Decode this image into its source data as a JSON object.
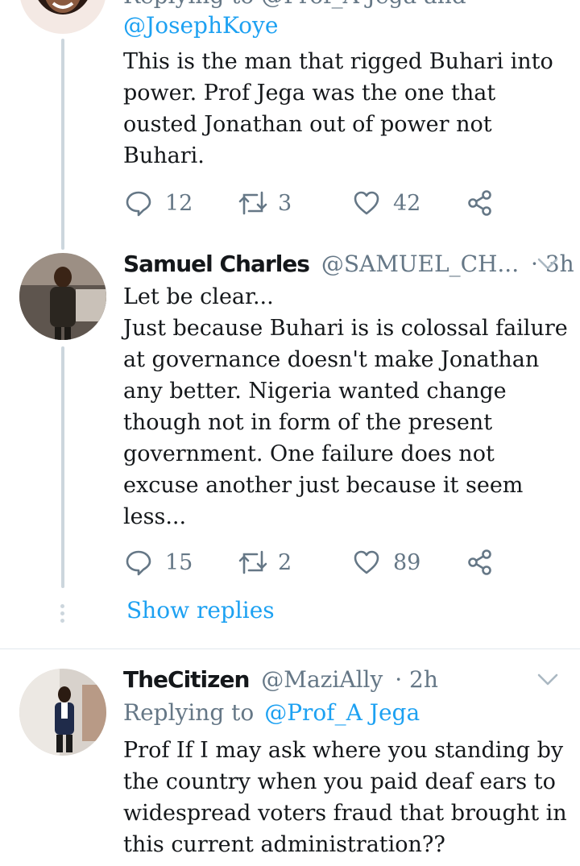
{
  "tweet1": {
    "replying_cut": "Replying to @Prof_A Jega and",
    "handle_line": "@JosephKoye",
    "text": "This is the man that rigged Buhari into\npower.  Prof  Jega was the one that\nousted  Jonathan out of power not\nBuhari.",
    "replies": "12",
    "retweets": "3",
    "likes": "42"
  },
  "tweet2": {
    "name": "Samuel Charles",
    "handle": "@SAMUEL_CH...",
    "time": "· 3h",
    "text": "Let be clear...\n Just because Buhari is is colossal failure\nat governance doesn't make  Jonathan\nany better. Nigeria wanted change\nthough not in form of the present\ngovernment. One failure does not\nexcuse another just because it seem\nless...",
    "replies": "15",
    "retweets": "2",
    "likes": "89",
    "show_replies": "Show replies"
  },
  "tweet3": {
    "name": "TheCitizen",
    "handle": "@MaziAlly",
    "time": "· 2h",
    "replying_label": "Replying to",
    "replying_handle": "@Prof_A Jega",
    "text": "Prof If I may ask where you standing by\nthe country when you paid deaf ears to\nwidespread voters fraud that brought in\nthis current administration??"
  },
  "icons": {
    "reply": "reply-icon",
    "retweet": "retweet-icon",
    "like": "heart-icon",
    "share": "share-icon",
    "more": "chevron-down-icon"
  },
  "colors": {
    "link": "#1da1f2",
    "muted": "#657786",
    "thread_line": "#ccd6dd",
    "text": "#14171a"
  }
}
